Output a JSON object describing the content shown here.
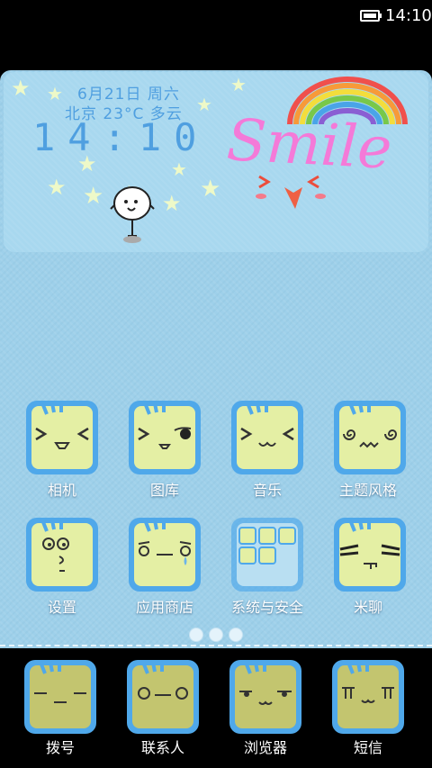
{
  "status_bar": {
    "time": "14:10"
  },
  "widget": {
    "date": "6月21日 周六",
    "weather": "北京 23°C 多云",
    "clock": "14:10",
    "smile_text": "Smile"
  },
  "apps": [
    {
      "label": "相机",
      "icon": "camera-face-icon"
    },
    {
      "label": "图库",
      "icon": "gallery-face-icon"
    },
    {
      "label": "音乐",
      "icon": "music-face-icon"
    },
    {
      "label": "主题风格",
      "icon": "theme-face-icon"
    },
    {
      "label": "设置",
      "icon": "settings-face-icon"
    },
    {
      "label": "应用商店",
      "icon": "app-store-face-icon"
    },
    {
      "label": "系统与安全",
      "icon": "system-folder-icon"
    },
    {
      "label": "米聊",
      "icon": "michat-face-icon"
    }
  ],
  "page_indicator": {
    "pages": 3,
    "current": 1
  },
  "dock": [
    {
      "label": "拨号",
      "icon": "phone-face-icon"
    },
    {
      "label": "联系人",
      "icon": "contacts-face-icon"
    },
    {
      "label": "浏览器",
      "icon": "browser-face-icon"
    },
    {
      "label": "短信",
      "icon": "sms-face-icon"
    }
  ],
  "colors": {
    "wallpaper": "#9ed0ea",
    "icon_frame": "#4fa8ea",
    "icon_face": "#e4efa4",
    "dock_face": "#c3c56f",
    "accent_text": "#4f9fe0",
    "smile_pink": "#f47ad8"
  }
}
